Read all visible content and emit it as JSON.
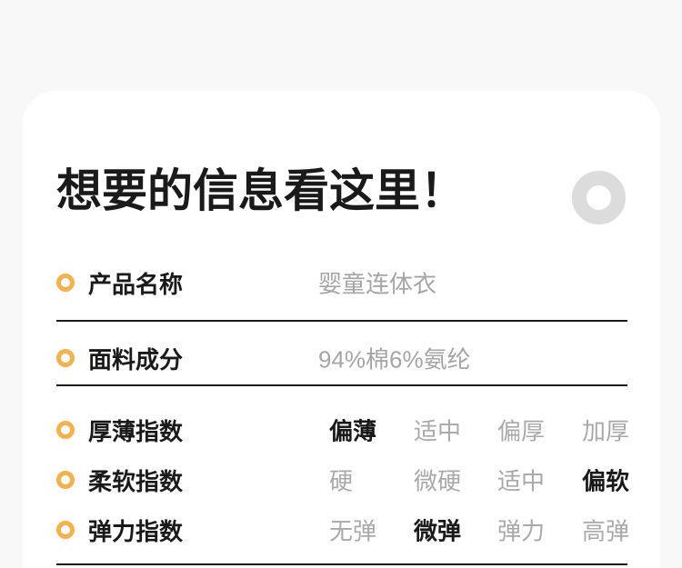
{
  "colors": {
    "page_bg": "#f8f8f8",
    "card_bg": "#ffffff",
    "accent_ring": "#f3b14f",
    "decor_ring": "#dcdcdc",
    "dark_text": "#1a1a1a",
    "muted_text": "#a5a5a5"
  },
  "card": {
    "title": "想要的信息看这里！",
    "info_rows": [
      {
        "label": "产品名称",
        "value": "婴童连体衣"
      },
      {
        "label": "面料成分",
        "value": "94%棉6%氨纶"
      }
    ],
    "index_rows": [
      {
        "label": "厚薄指数",
        "options": [
          "偏薄",
          "适中",
          "偏厚",
          "加厚"
        ],
        "active": 0
      },
      {
        "label": "柔软指数",
        "options": [
          "硬",
          "微硬",
          "适中",
          "偏软"
        ],
        "active": 3
      },
      {
        "label": "弹力指数",
        "options": [
          "无弹",
          "微弹",
          "弹力",
          "高弹"
        ],
        "active": 1
      }
    ]
  }
}
